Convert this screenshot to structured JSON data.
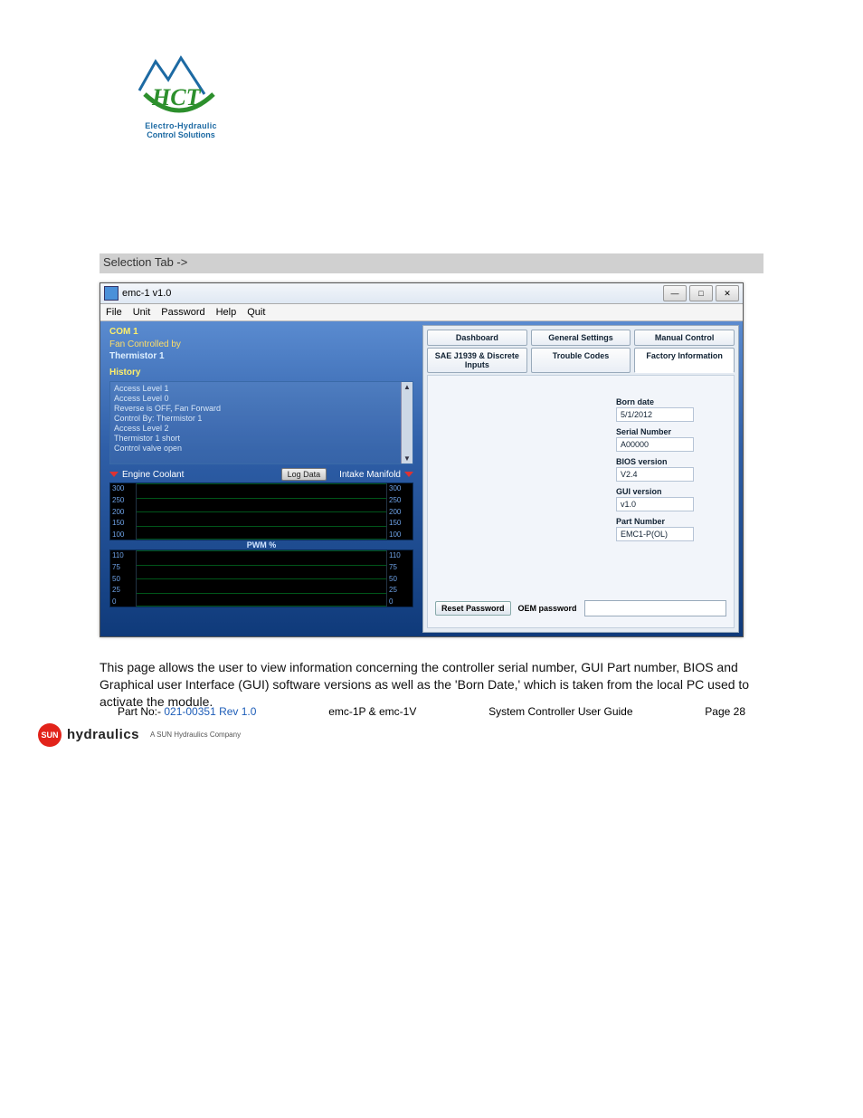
{
  "header_logo": {
    "line1": "Electro-Hydraulic",
    "line2": "Control Solutions",
    "brand": "HCT"
  },
  "section_heading": "Selection Tab ->",
  "app": {
    "title": "emc-1 v1.0",
    "menu": [
      "File",
      "Unit",
      "Password",
      "Help",
      "Quit"
    ],
    "win_controls": [
      "minimize",
      "maximize",
      "close"
    ],
    "left": {
      "com": "COM 1",
      "fan_by_label": "Fan Controlled by",
      "fan_by_value": "Thermistor 1",
      "history_label": "History",
      "history_lines": [
        "Access Level 1",
        "Access Level 0",
        "Reverse is OFF, Fan Forward",
        "Control By: Thermistor 1",
        "Access Level 2",
        "Thermistor 1 short",
        "Control valve open"
      ],
      "chart1_left_label": "Engine Coolant",
      "log_button": "Log Data",
      "chart1_right_label": "Intake Manifold",
      "pwm_label": "PWM %",
      "chart1_y": [
        "300",
        "250",
        "200",
        "150",
        "100"
      ],
      "chart2_y_left": [
        "110",
        "75",
        "50",
        "25",
        "0"
      ],
      "chart2_y_right": [
        "110",
        "75",
        "50",
        "25",
        "0"
      ]
    },
    "tabs_row1": [
      "Dashboard",
      "General Settings",
      "Manual Control"
    ],
    "tabs_row2": [
      "SAE J1939 & Discrete Inputs",
      "Trouble Codes",
      "Factory Information"
    ],
    "info": {
      "born_label": "Born date",
      "born_value": "5/1/2012",
      "serial_label": "Serial Number",
      "serial_value": "A00000",
      "bios_label": "BIOS version",
      "bios_value": "V2.4",
      "gui_label": "GUI version",
      "gui_value": "v1.0",
      "part_label": "Part Number",
      "part_value": "EMC1-P(OL)"
    },
    "oem_label": "OEM password",
    "reset_label": "Reset Password"
  },
  "body_text": "This page allows the user to view information concerning the controller serial number, GUI Part number, BIOS and Graphical user Interface (GUI) software versions as well as the 'Born Date,' which is taken from the local PC used to activate the module.",
  "footer": {
    "part_prefix": "Part No:- ",
    "part_no": "021-00351 Rev 1.0",
    "center1": "emc-1P & emc-1V",
    "center2": "System Controller User Guide",
    "page": "Page 28",
    "sun_text": "SUN",
    "hyd_text": "hydraulics",
    "sub": "A SUN Hydraulics Company"
  },
  "chart_data": [
    {
      "type": "line",
      "title": "Engine Coolant / Intake Manifold",
      "ylim_left": [
        100,
        300
      ],
      "ylim_right": [
        100,
        300
      ],
      "series": [
        {
          "name": "Engine Coolant",
          "values": []
        },
        {
          "name": "Intake Manifold",
          "values": []
        }
      ]
    },
    {
      "type": "line",
      "title": "PWM %",
      "ylim": [
        0,
        110
      ],
      "series": [
        {
          "name": "PWM",
          "values": []
        }
      ]
    }
  ]
}
